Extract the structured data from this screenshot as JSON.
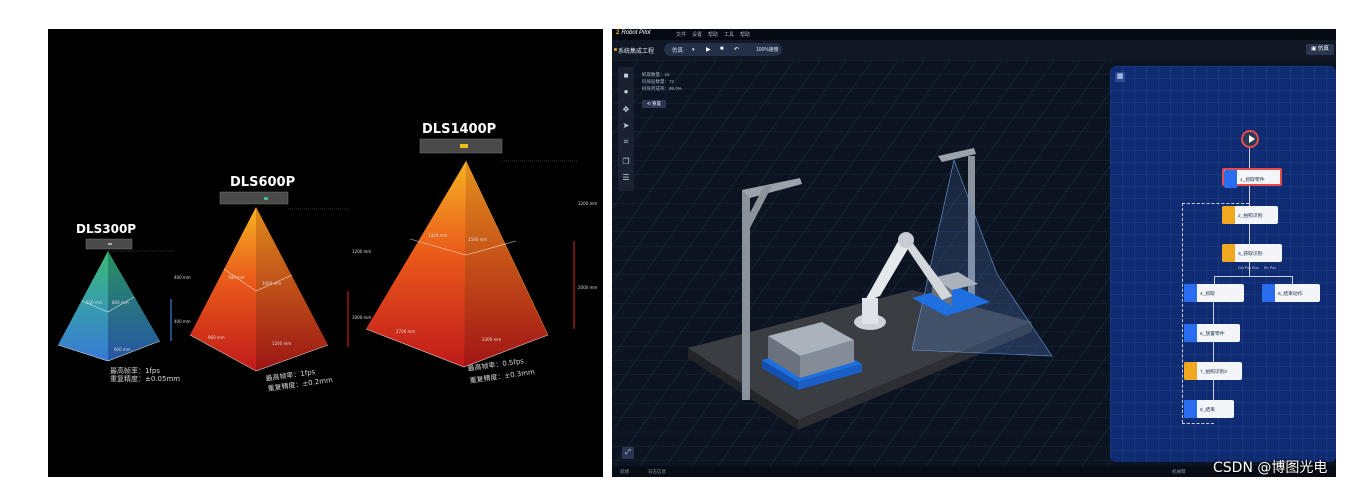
{
  "left_panel": {
    "products": [
      {
        "title": "DLS300P",
        "dims": [
          "400 mm",
          "400 mm",
          "550 mm",
          "800 mm",
          "600 mm"
        ],
        "specs": [
          {
            "label": "最高帧率：",
            "value": "1fps"
          },
          {
            "label": "重复精度：",
            "value": "±0.05mm"
          }
        ]
      },
      {
        "title": "DLS600P",
        "dims": [
          "1200 mm",
          "1000 mm",
          "580 mm",
          "1000 mm",
          "960 mm",
          "1200 mm"
        ],
        "specs": [
          {
            "label": "最高帧率：",
            "value": "1fps"
          },
          {
            "label": "重复精度：",
            "value": "±0.2mm"
          }
        ]
      },
      {
        "title": "DLS1400P",
        "dims": [
          "1200 mm",
          "2000 mm",
          "1400 mm",
          "1500 mm",
          "2700 mm",
          "3300 mm"
        ],
        "specs": [
          {
            "label": "最高帧率：",
            "value": "0.5fps"
          },
          {
            "label": "重复精度：",
            "value": "±0.3mm"
          }
        ]
      }
    ],
    "colors": {
      "green_pyramid": "#35c08a",
      "blue_pyramid": "#3a7bd5",
      "orange_pyramid": "#f07d1a",
      "red_pyramid": "#c8201c"
    }
  },
  "right_panel": {
    "app_brand": "Robot Pilot",
    "brand_mark": "2",
    "menus": [
      "文件",
      "设置",
      "帮助",
      "工具",
      "帮助"
    ],
    "project_name": "系统集成工程",
    "run_mode": "仿真",
    "toolbar_icons": [
      "play-icon",
      "stop-icon",
      "undo-icon"
    ],
    "run_speed": "100%速度",
    "top_right_button": "仿真",
    "scene_info": [
      "抓取数量：18",
      "码垛层数量：72",
      "码垛完成率：99.0%"
    ],
    "scene_button": "重置",
    "left_tools": [
      "cube-icon",
      "sphere-icon",
      "move-icon",
      "arrow-icon",
      "axis-icon",
      "copy-icon",
      "layers-icon"
    ],
    "status_left": [
      "就绪",
      "日志信息"
    ],
    "status_right": "机械臂",
    "flow": {
      "nodes": [
        {
          "label": "1_抓取零件",
          "color": "blue"
        },
        {
          "label": "2_拍照识别",
          "color": "amber"
        },
        {
          "label": "3_获取识别",
          "color": "amber"
        },
        {
          "label": "4_抓取",
          "color": "blue"
        },
        {
          "label": "5_结束动作",
          "color": "blue"
        },
        {
          "label": "6_放置零件",
          "color": "blue"
        },
        {
          "label": "7_拍照识别2",
          "color": "amber"
        },
        {
          "label": "8_结束",
          "color": "blue"
        }
      ],
      "branch_labels": [
        "Get Pos",
        "Run",
        "Err Pos"
      ]
    }
  },
  "watermark": "CSDN @博图光电"
}
